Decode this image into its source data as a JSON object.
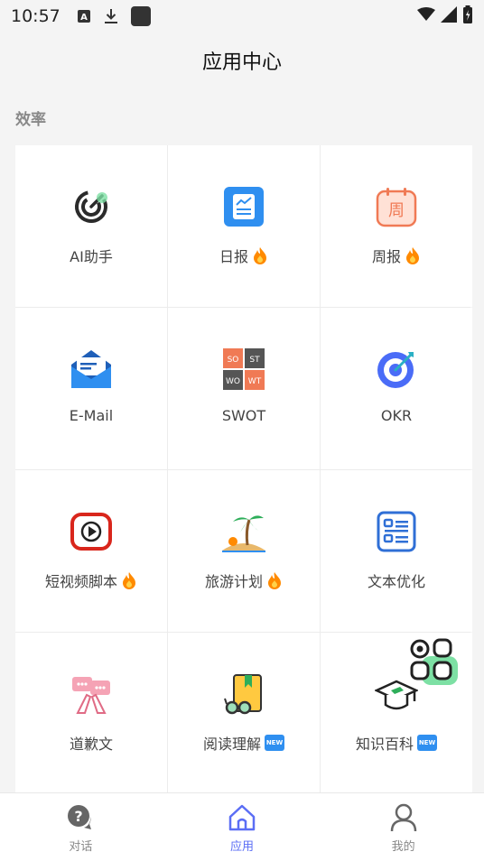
{
  "status": {
    "time": "10:57"
  },
  "header": {
    "title": "应用中心"
  },
  "section": {
    "title": "效率"
  },
  "apps": [
    {
      "label": "AI助手",
      "icon": "ai-assistant-icon",
      "badge": ""
    },
    {
      "label": "日报",
      "icon": "daily-report-icon",
      "badge": "fire"
    },
    {
      "label": "周报",
      "icon": "weekly-report-icon",
      "badge": "fire"
    },
    {
      "label": "E-Mail",
      "icon": "email-icon",
      "badge": ""
    },
    {
      "label": "SWOT",
      "icon": "swot-icon",
      "badge": "",
      "tiles": [
        "SO",
        "ST",
        "WO",
        "WT"
      ]
    },
    {
      "label": "OKR",
      "icon": "okr-target-icon",
      "badge": ""
    },
    {
      "label": "短视频脚本",
      "icon": "video-play-icon",
      "badge": "fire"
    },
    {
      "label": "旅游计划",
      "icon": "island-icon",
      "badge": "fire"
    },
    {
      "label": "文本优化",
      "icon": "text-list-icon",
      "badge": ""
    },
    {
      "label": "道歉文",
      "icon": "apology-hands-icon",
      "badge": ""
    },
    {
      "label": "阅读理解",
      "icon": "reading-book-icon",
      "badge": "new"
    },
    {
      "label": "知识百科",
      "icon": "graduation-cap-icon",
      "badge": "new"
    }
  ],
  "badge_new_text": "NEW",
  "nav": [
    {
      "label": "对话",
      "icon": "chat-icon",
      "active": false
    },
    {
      "label": "应用",
      "icon": "home-icon",
      "active": true
    },
    {
      "label": "我的",
      "icon": "profile-icon",
      "active": false
    }
  ],
  "colors": {
    "accent": "#5b6ef5",
    "fire": "#ff8a00",
    "new_badge": "#2f8ff0"
  }
}
